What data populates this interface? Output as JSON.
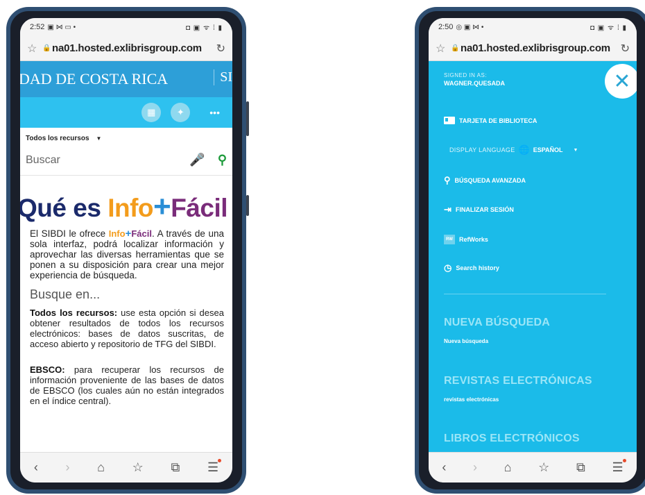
{
  "left": {
    "status": {
      "time": "2:52",
      "icons_left": "▣ ⋈ ▭ •",
      "icons_right": "◘ ▣ ᯤ ⁞ ▮"
    },
    "url": "na01.hosted.exlibrisgroup.com",
    "banner": {
      "title": "DAD DE COSTA RICA",
      "right": "SI"
    },
    "scope": "Todos los recursos",
    "search_placeholder": "Buscar",
    "hero": {
      "q": "Qué es ",
      "info": "Info",
      "plus": "+",
      "facil": "Fácil"
    },
    "intro_pre": "El SIBDI le ofrece ",
    "intro_logo": {
      "info": "Info",
      "plus": "+",
      "facil": "Fácil"
    },
    "intro_post": ". A través de una sola interfaz, podrá localizar información y aprovechar las diversas herramientas que se ponen a su disposición para crear una mejor experiencia de búsqueda.",
    "subhead": "Busque en...",
    "p1_bold": "Todos los recursos:",
    "p1_text": " use esta opción si desea obtener resultados de todos los recursos electrónicos: bases de datos suscritas, de acceso abierto y repositorio de TFG del SIBDI.",
    "p2_bold": "EBSCO:",
    "p2_text": " para recuperar los recursos de información proveniente de las bases de datos de EBSCO (los cuales aún no están integrados en el índice central)."
  },
  "right": {
    "status": {
      "time": "2:50",
      "icons_left": "◎ ▣ ⋈ •",
      "icons_right": "◘ ▣ ᯤ ⁞ ▮"
    },
    "url": "na01.hosted.exlibrisgroup.com",
    "signed_label": "SIGNED IN AS:",
    "signed_user": "WAGNER.QUESADA",
    "menu": {
      "card": "TARJETA DE BIBLIOTECA",
      "lang_label": "DISPLAY LANGUAGE",
      "lang_value": "ESPAÑOL",
      "advanced": "BÚSQUEDA AVANZADA",
      "logout": "FINALIZAR SESIÓN",
      "refworks": "RefWorks",
      "history": "Search history"
    },
    "sections": [
      {
        "title": "NUEVA BÚSQUEDA",
        "sub": "Nueva búsqueda"
      },
      {
        "title": "REVISTAS ELECTRÓNICAS",
        "sub": "revistas electrónicas"
      },
      {
        "title": "LIBROS ELECTRÓNICOS",
        "sub": ""
      }
    ],
    "refworks_abbr": "RW"
  },
  "nav": {
    "back": "‹",
    "forward": "›",
    "home": "⌂",
    "bookmarks": "☆",
    "tabs": "⧉",
    "menu": "☰"
  },
  "colors": {
    "banner": "#2d9fd8",
    "toolbar": "#2ec1ef",
    "menu_bg": "#1bbbe9",
    "frame": "#2f4f72"
  }
}
